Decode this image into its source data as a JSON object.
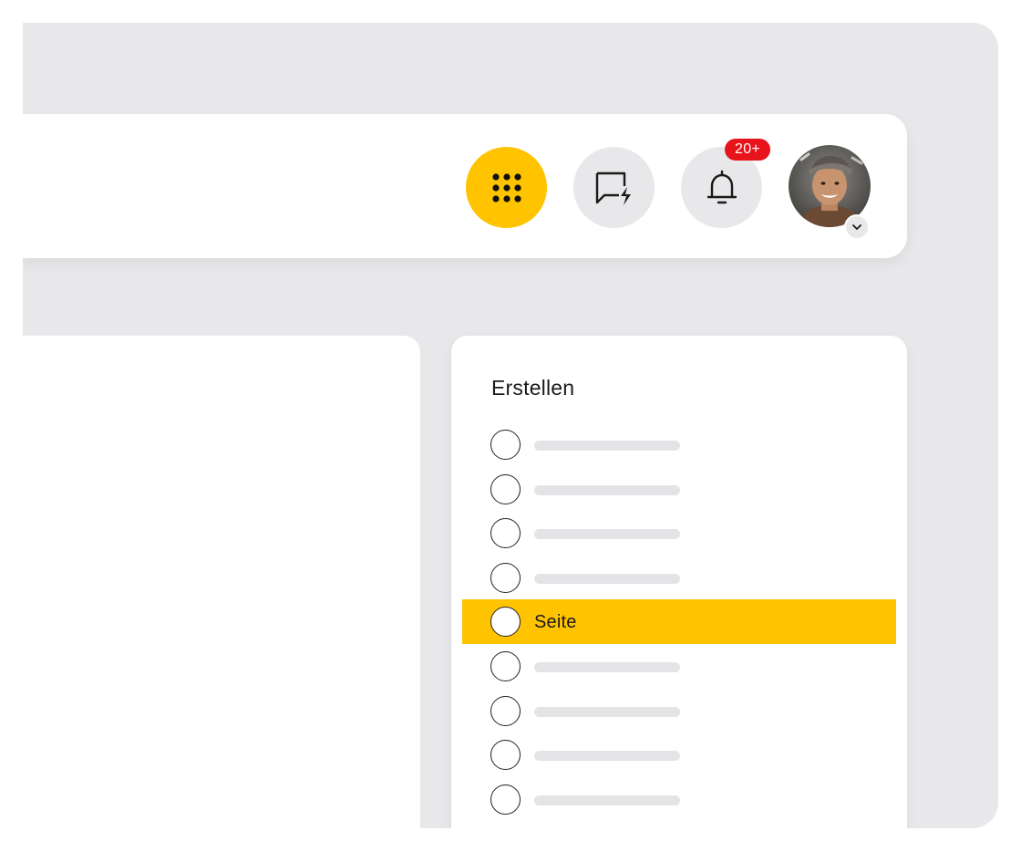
{
  "header": {
    "apps_icon": "grid-dots-icon",
    "quick_icon": "chat-bolt-icon",
    "bell_icon": "bell-icon",
    "notification_count": "20+",
    "avatar_icon": "user-photo-avatar",
    "caret_icon": "chevron-down-icon"
  },
  "create_panel": {
    "title": "Erstellen",
    "items": [
      {
        "label": "",
        "selected": false
      },
      {
        "label": "",
        "selected": false
      },
      {
        "label": "",
        "selected": false
      },
      {
        "label": "",
        "selected": false
      },
      {
        "label": "Seite",
        "selected": true
      },
      {
        "label": "",
        "selected": false
      },
      {
        "label": "",
        "selected": false
      },
      {
        "label": "",
        "selected": false
      },
      {
        "label": "",
        "selected": false
      }
    ]
  },
  "colors": {
    "accent": "#ffc300",
    "badge": "#e8141b",
    "background": "#e8e8ea",
    "surface": "#ffffff"
  }
}
